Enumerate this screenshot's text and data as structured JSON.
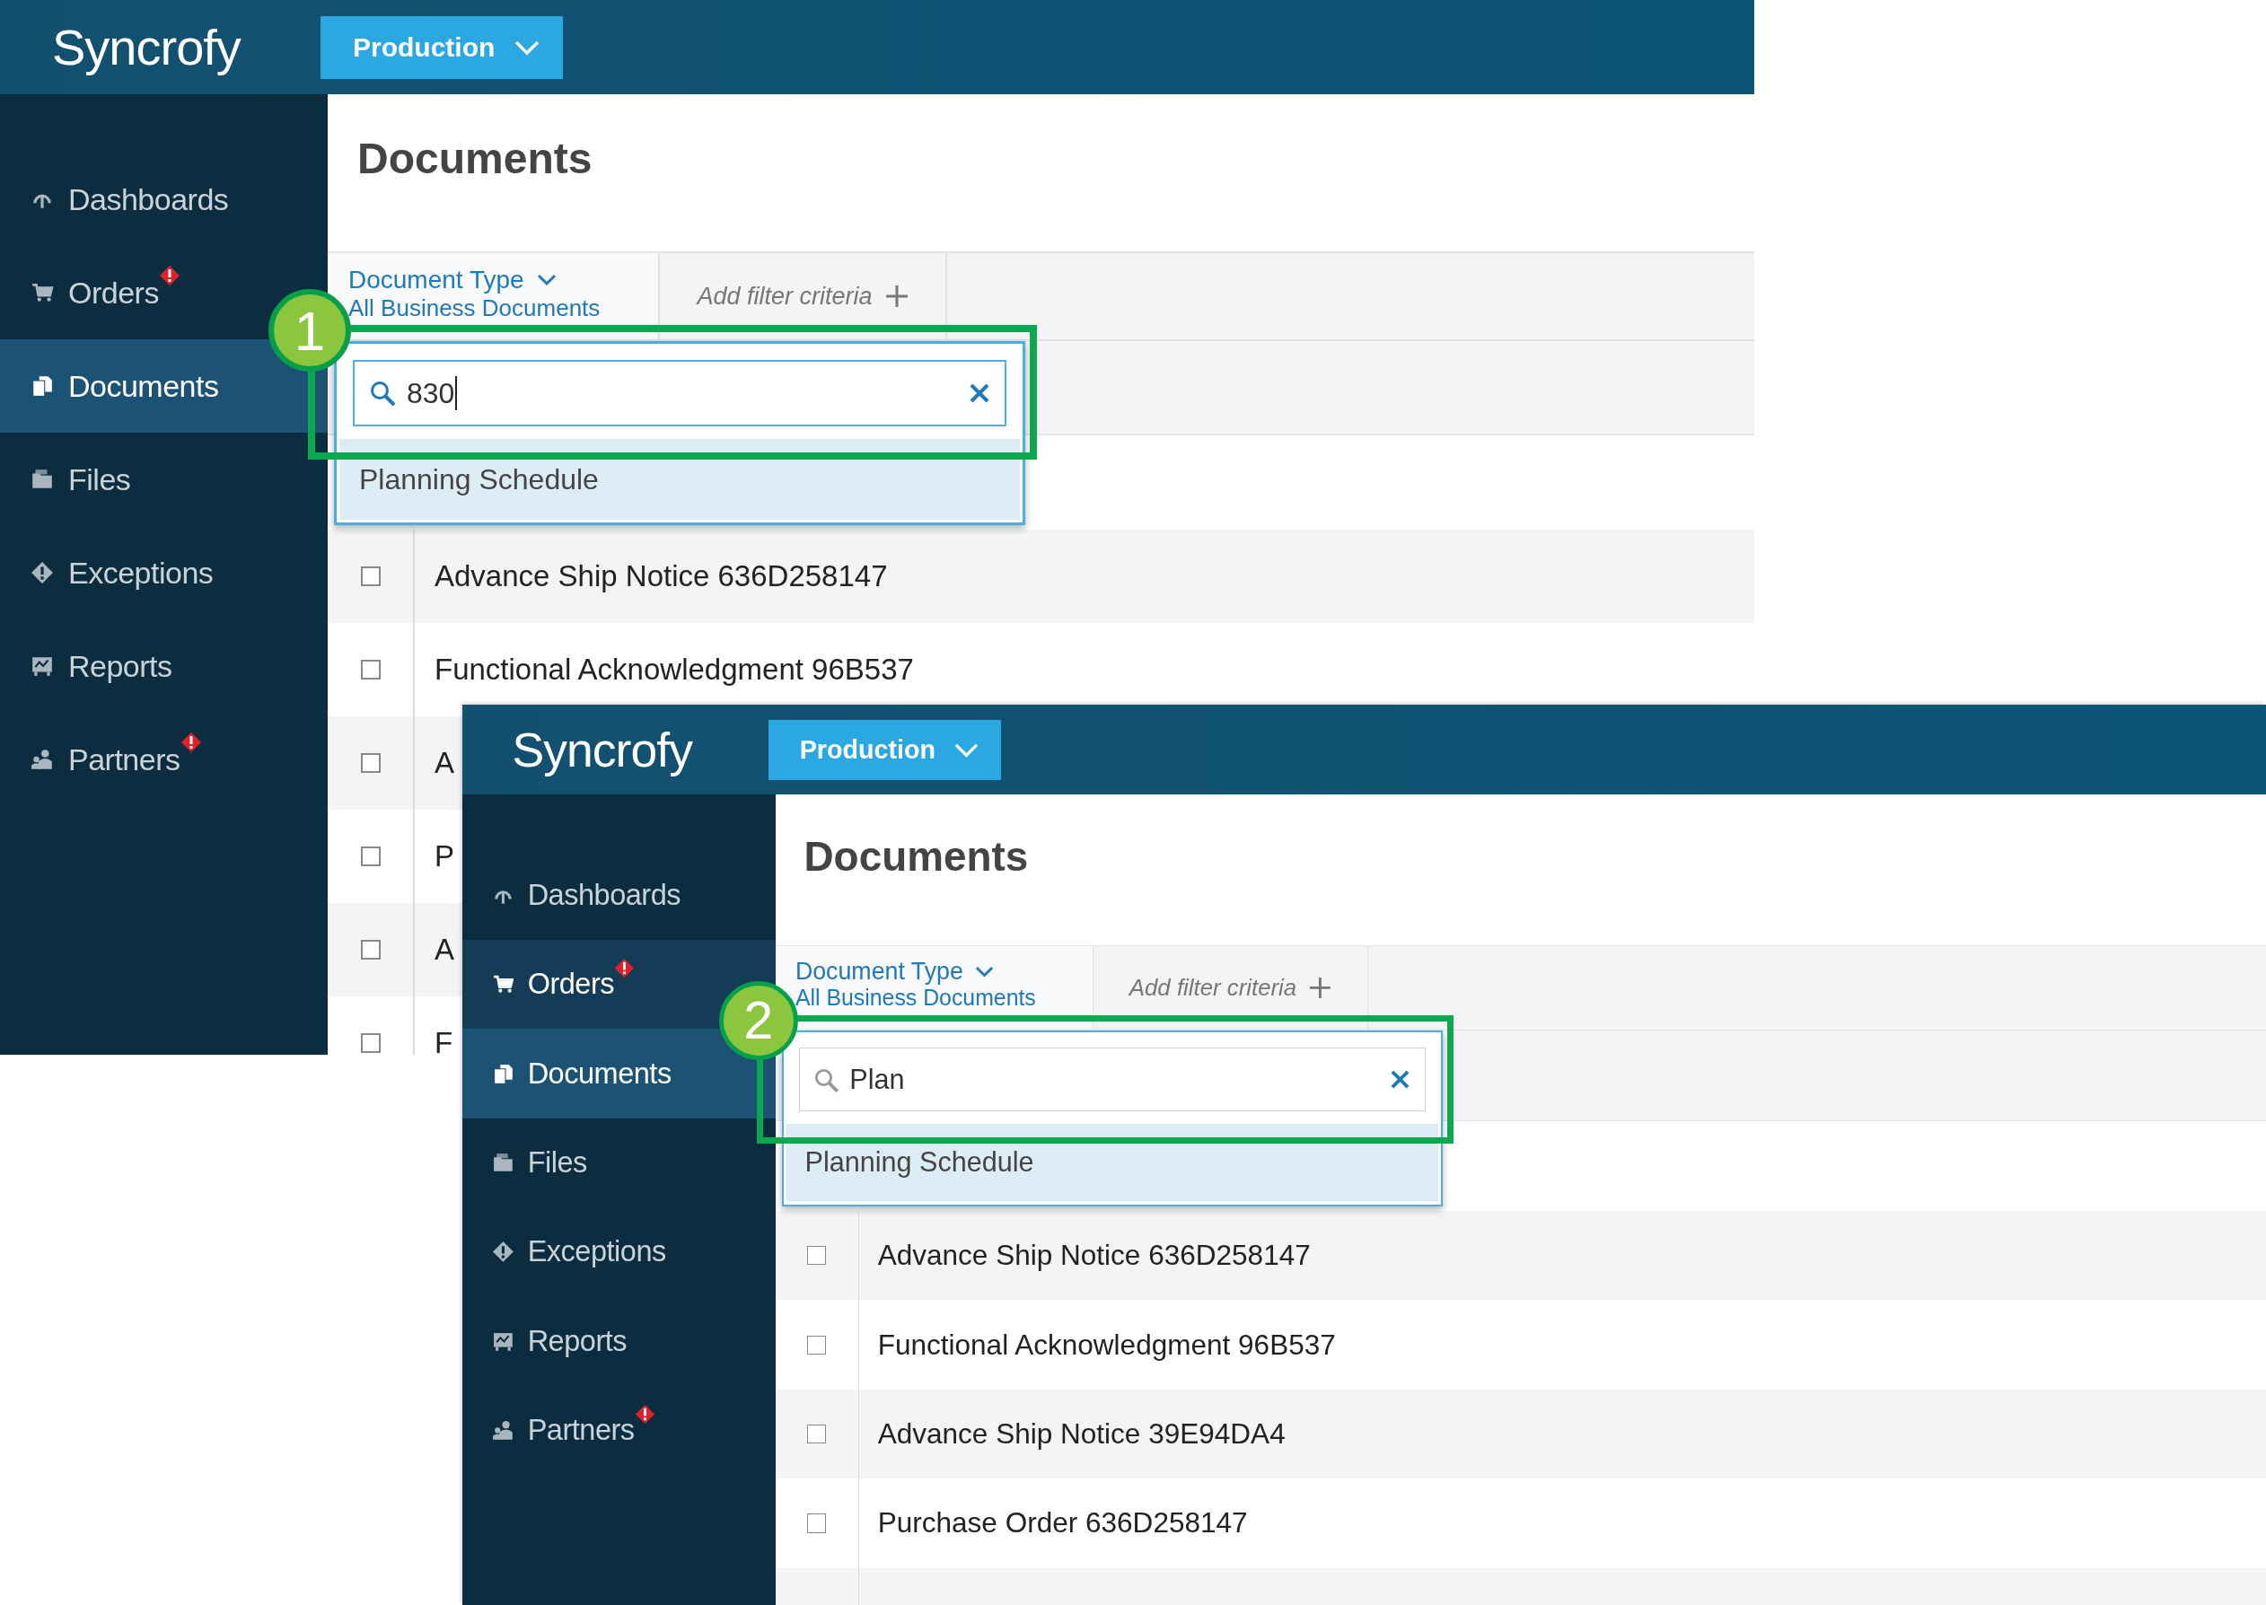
{
  "screens": [
    {
      "logo": "Syncrofy",
      "environment": "Production",
      "nav": [
        {
          "label": "Dashboards",
          "kind": "gauge",
          "selected": false,
          "hovered": false,
          "alert": false
        },
        {
          "label": "Orders",
          "kind": "cart",
          "selected": false,
          "hovered": false,
          "alert": true
        },
        {
          "label": "Documents",
          "kind": "documents",
          "selected": true,
          "hovered": false,
          "alert": false
        },
        {
          "label": "Files",
          "kind": "folder",
          "selected": false,
          "hovered": false,
          "alert": false
        },
        {
          "label": "Exceptions",
          "kind": "exception",
          "selected": false,
          "hovered": false,
          "alert": false
        },
        {
          "label": "Reports",
          "kind": "report",
          "selected": false,
          "hovered": false,
          "alert": false
        },
        {
          "label": "Partners",
          "kind": "partner",
          "selected": false,
          "hovered": false,
          "alert": true
        }
      ],
      "title": "Documents",
      "filter": {
        "label": "Document Type",
        "value": "All Business Documents",
        "add_label": "Add filter criteria"
      },
      "search": {
        "value": "830",
        "focused": true
      },
      "suggestions": [
        "Planning Schedule"
      ],
      "rows": [
        {
          "label": "Advance Ship Notice 636D258147",
          "checked": false
        },
        {
          "label": "Functional Acknowledgment 96B537",
          "checked": false
        },
        {
          "label": "A",
          "checked": false
        },
        {
          "label": "P",
          "checked": false
        },
        {
          "label": "A",
          "checked": false
        },
        {
          "label": "F",
          "checked": false
        }
      ],
      "step": "1"
    },
    {
      "logo": "Syncrofy",
      "environment": "Production",
      "nav": [
        {
          "label": "Dashboards",
          "kind": "gauge",
          "selected": false,
          "hovered": false,
          "alert": false
        },
        {
          "label": "Orders",
          "kind": "cart",
          "selected": false,
          "hovered": true,
          "alert": true
        },
        {
          "label": "Documents",
          "kind": "documents",
          "selected": true,
          "hovered": false,
          "alert": false
        },
        {
          "label": "Files",
          "kind": "folder",
          "selected": false,
          "hovered": false,
          "alert": false
        },
        {
          "label": "Exceptions",
          "kind": "exception",
          "selected": false,
          "hovered": false,
          "alert": false
        },
        {
          "label": "Reports",
          "kind": "report",
          "selected": false,
          "hovered": false,
          "alert": false
        },
        {
          "label": "Partners",
          "kind": "partner",
          "selected": false,
          "hovered": false,
          "alert": true
        }
      ],
      "title": "Documents",
      "filter": {
        "label": "Document Type",
        "value": "All Business Documents",
        "add_label": "Add filter criteria"
      },
      "search": {
        "value": "Plan",
        "focused": false
      },
      "suggestions": [
        "Planning Schedule"
      ],
      "rows": [
        {
          "label": "Advance Ship Notice 636D258147",
          "checked": false
        },
        {
          "label": "Functional Acknowledgment 96B537",
          "checked": false
        },
        {
          "label": "Advance Ship Notice 39E94DA4",
          "checked": false
        },
        {
          "label": "Purchase Order 636D258147",
          "checked": false
        }
      ],
      "step": "2"
    }
  ]
}
